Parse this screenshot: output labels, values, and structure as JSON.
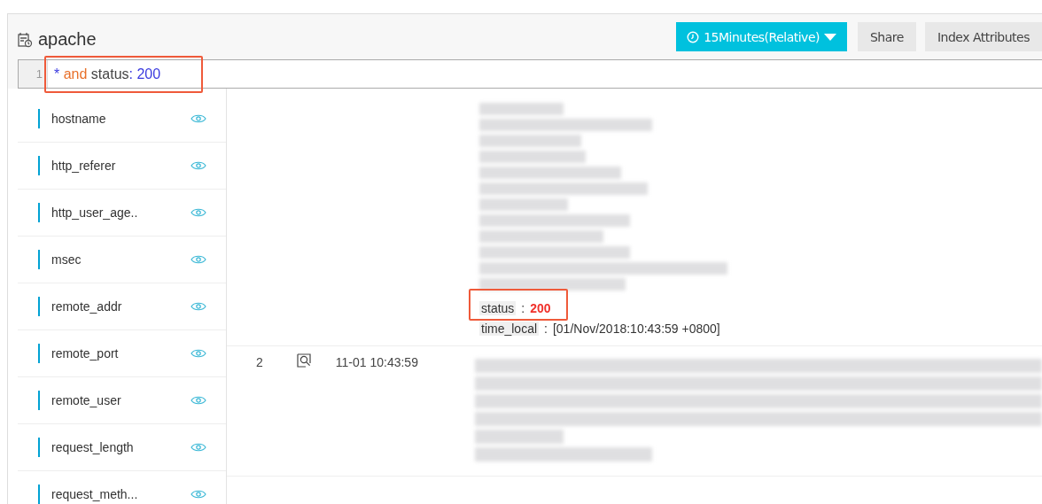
{
  "logstore": {
    "title": "apache"
  },
  "toolbar": {
    "time_range": "15Minutes(Relative)",
    "buttons": [
      "Share",
      "Index Attributes"
    ]
  },
  "query": {
    "line_number": "1",
    "tokens": [
      {
        "kind": "wildcard",
        "text": "*"
      },
      {
        "kind": "keyword",
        "text": "and"
      },
      {
        "kind": "field",
        "text": "status"
      },
      {
        "kind": "value",
        "text": ": 200"
      }
    ],
    "highlighted": true
  },
  "fields": [
    {
      "name": "hostname"
    },
    {
      "name": "http_referer"
    },
    {
      "name": "http_user_age.."
    },
    {
      "name": "msec"
    },
    {
      "name": "remote_addr"
    },
    {
      "name": "remote_port"
    },
    {
      "name": "remote_user"
    },
    {
      "name": "request_length"
    },
    {
      "name": "request_meth..."
    }
  ],
  "logs": [
    {
      "fields": [
        {
          "key": "status",
          "separator": ":",
          "value": "200",
          "matched": true,
          "highlighted": true
        },
        {
          "key": "time_local",
          "separator": ":",
          "value": "[01/Nov/2018:10:43:59 +0800]",
          "matched": false,
          "highlighted": false
        }
      ]
    },
    {
      "number": "2",
      "time": "11-01 10:43:59"
    }
  ]
}
